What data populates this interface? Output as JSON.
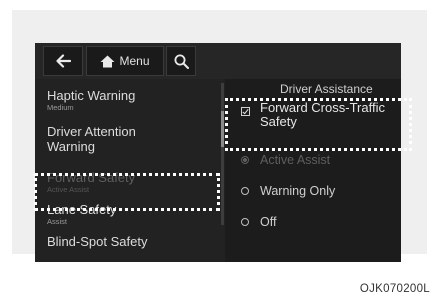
{
  "toolbar": {
    "back_icon": "arrow-left-icon",
    "home_icon": "home-icon",
    "menu_label": "Menu",
    "search_icon": "search-icon"
  },
  "left_menu": {
    "items": [
      {
        "label": "Haptic Warning",
        "sub": "Medium"
      },
      {
        "label": "Driver Attention Warning",
        "sub": ""
      },
      {
        "label": "Forward Safety",
        "sub": "Active Assist",
        "highlighted": true
      },
      {
        "label": "Lane Safety",
        "sub": "Assist"
      },
      {
        "label": "Blind-Spot Safety",
        "sub": ""
      }
    ]
  },
  "right_panel": {
    "title": "Driver Assistance",
    "checkbox_label": "Forward Cross-Traffic Safety",
    "checkbox_checked": true,
    "options": [
      {
        "label": "Active Assist",
        "selected": true
      },
      {
        "label": "Warning Only",
        "selected": false
      },
      {
        "label": "Off",
        "selected": false
      }
    ]
  },
  "caption": "OJK070200L",
  "colors": {
    "screen_bg": "#262626",
    "highlight_border": "#ffffff"
  }
}
